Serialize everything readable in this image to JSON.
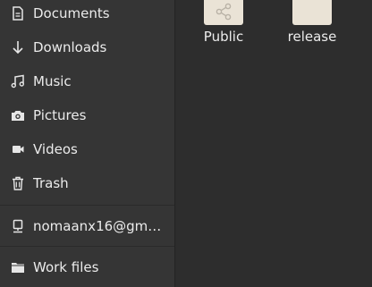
{
  "sidebar": {
    "items": [
      {
        "label": "Documents",
        "icon": "document-icon"
      },
      {
        "label": "Downloads",
        "icon": "download-icon"
      },
      {
        "label": "Music",
        "icon": "music-icon"
      },
      {
        "label": "Pictures",
        "icon": "camera-icon"
      },
      {
        "label": "Videos",
        "icon": "video-icon"
      },
      {
        "label": "Trash",
        "icon": "trash-icon"
      },
      {
        "label": "nomaanx16@gm…",
        "icon": "network-account-icon"
      },
      {
        "label": "Work files",
        "icon": "folder-icon"
      }
    ]
  },
  "main": {
    "folders": [
      {
        "name": "Public",
        "icon": "share-icon"
      },
      {
        "name": "release",
        "icon": "folder-icon"
      }
    ]
  },
  "colors": {
    "sidebar_bg": "#353535",
    "main_bg": "#2d2d2d",
    "text": "#ebebeb",
    "folder": "#eae3d6"
  }
}
